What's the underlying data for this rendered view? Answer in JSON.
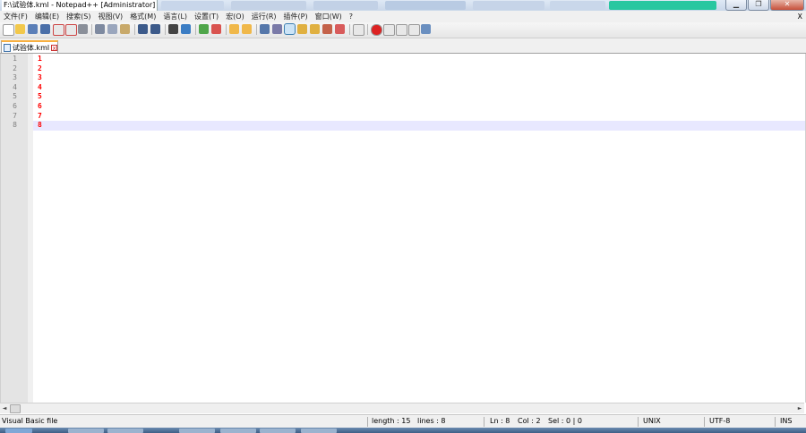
{
  "window": {
    "title": "F:\\试验体.kml - Notepad++ [Administrator]",
    "close_glyph": "✕",
    "max_glyph": "❐",
    "min_glyph": "▁"
  },
  "menu": {
    "items": [
      "文件(F)",
      "编辑(E)",
      "搜索(S)",
      "视图(V)",
      "格式(M)",
      "语言(L)",
      "设置(T)",
      "宏(O)",
      "运行(R)",
      "插件(P)",
      "窗口(W)",
      "?"
    ],
    "close": "X"
  },
  "toolbar": {
    "icons": [
      "new-file-icon",
      "open-file-icon",
      "save-icon",
      "save-all-icon",
      "close-icon",
      "close-all-icon",
      "print-icon",
      "cut-icon",
      "copy-icon",
      "paste-icon",
      "undo-icon",
      "redo-icon",
      "find-icon",
      "replace-icon",
      "zoom-in-icon",
      "zoom-out-icon",
      "sync-vertical-icon",
      "sync-horizontal-icon",
      "word-wrap-icon",
      "show-all-chars-icon",
      "indent-guide-icon",
      "doc-map-icon",
      "function-list-icon",
      "folder-workspace-icon",
      "monitor-icon",
      "record-macro-icon",
      "stop-macro-icon",
      "play-macro-icon",
      "run-macro-multiple-icon",
      "save-macro-icon"
    ],
    "active_icon": "indent-guide-icon"
  },
  "tab": {
    "label": "试验体.kml",
    "close": "x"
  },
  "editor": {
    "line_numbers": [
      "1",
      "2",
      "3",
      "4",
      "5",
      "6",
      "7",
      "8"
    ],
    "lines": [
      "1",
      "2",
      "3",
      "4",
      "5",
      "6",
      "7",
      "8"
    ],
    "current_line": 8,
    "text_color": "#ff0000",
    "current_line_color": "#e8e8ff"
  },
  "status": {
    "file_type": "Visual Basic file",
    "length": "length : 15",
    "lines": "lines : 8",
    "ln": "Ln : 8",
    "col": "Col : 2",
    "sel": "Sel : 0 | 0",
    "eol": "UNIX",
    "encoding": "UTF-8",
    "mode": "INS"
  },
  "scrollbar": {
    "left": "◄",
    "right": "►"
  }
}
